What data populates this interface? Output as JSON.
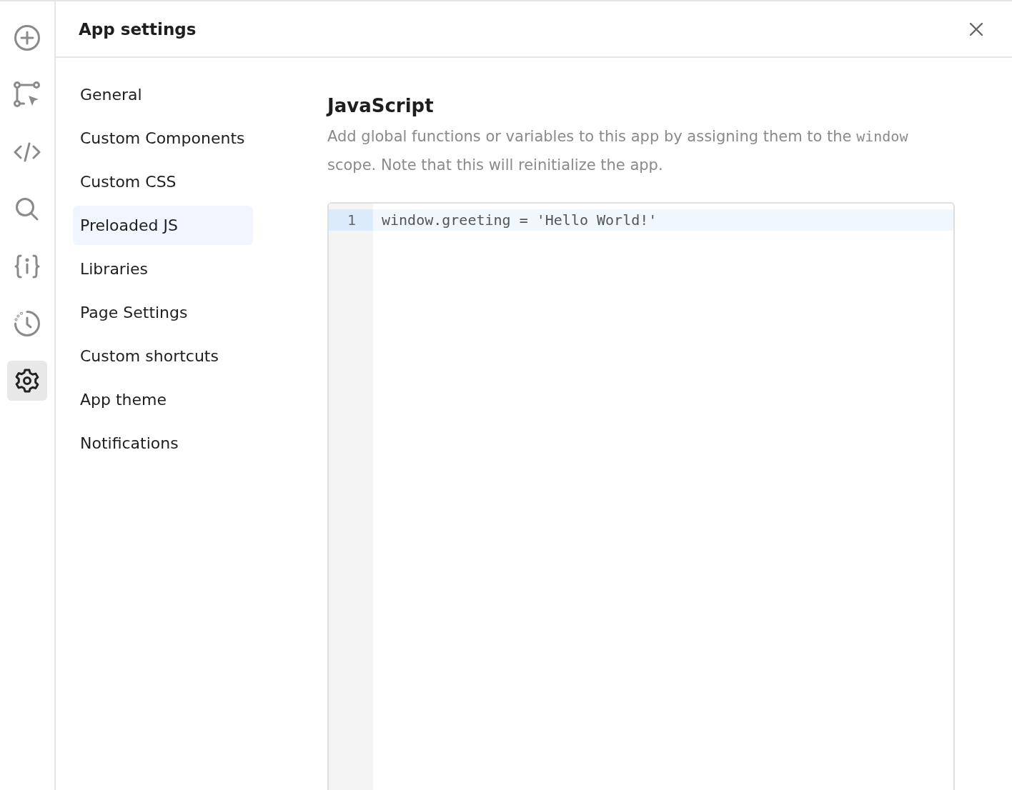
{
  "rail": [
    {
      "kind": "add",
      "selected": false
    },
    {
      "kind": "select",
      "selected": false
    },
    {
      "kind": "code",
      "selected": false
    },
    {
      "kind": "search",
      "selected": false
    },
    {
      "kind": "variables",
      "selected": false
    },
    {
      "kind": "history",
      "selected": false
    },
    {
      "kind": "settings",
      "selected": true
    }
  ],
  "dialog": {
    "title": "App settings"
  },
  "nav": [
    {
      "label": "General",
      "selected": false
    },
    {
      "label": "Custom Components",
      "selected": false
    },
    {
      "label": "Custom CSS",
      "selected": false
    },
    {
      "label": "Preloaded JS",
      "selected": true
    },
    {
      "label": "Libraries",
      "selected": false
    },
    {
      "label": "Page Settings",
      "selected": false
    },
    {
      "label": "Custom shortcuts",
      "selected": false
    },
    {
      "label": "App theme",
      "selected": false
    },
    {
      "label": "Notifications",
      "selected": false
    }
  ],
  "section": {
    "heading": "JavaScript",
    "description": [
      {
        "kind": "text",
        "text": "Add global functions or variables to this app by assigning them to the "
      },
      {
        "kind": "code",
        "text": "window"
      },
      {
        "kind": "text",
        "text": " scope. Note that this will reinitialize the app."
      }
    ]
  },
  "editor": {
    "lines": [
      {
        "number": "1",
        "code": "window.greeting = 'Hello World!'",
        "selected": true
      }
    ]
  }
}
